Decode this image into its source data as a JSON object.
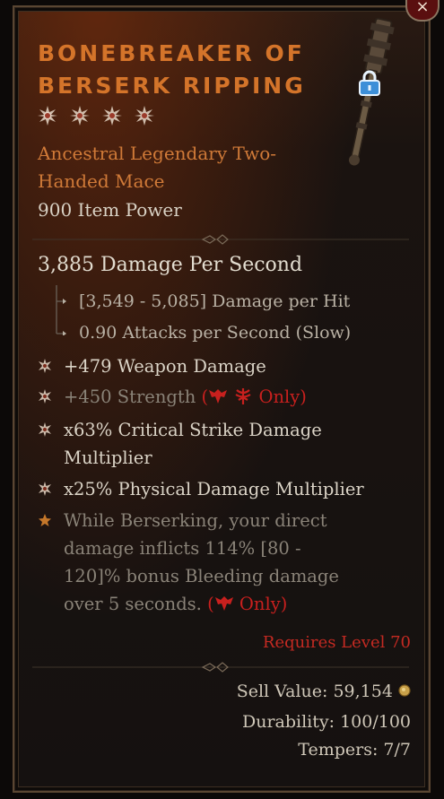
{
  "close_icon": "×",
  "item": {
    "title": "BONEBREAKER OF BERSERK RIPPING",
    "star_count": 4,
    "type": "Ancestral Legendary Two-Handed Mace",
    "power": "900 Item Power"
  },
  "stats": {
    "dps": "3,885 Damage Per Second",
    "damage_per_hit": "[3,549 - 5,085] Damage per Hit",
    "attack_speed": "0.90 Attacks per Second (Slow)"
  },
  "affixes": [
    {
      "text": "+479 Weapon Damage"
    },
    {
      "text": "+450 Strength",
      "restriction_open": "(",
      "restriction_close": "Only)"
    },
    {
      "text": "x63% Critical Strike Damage Multiplier"
    },
    {
      "text": "x25% Physical Damage Multiplier"
    }
  ],
  "aspect": {
    "text": "While Berserking, your direct damage inflicts 114% [80 - 120]% bonus Bleeding damage over 5 seconds.",
    "restriction_open": "(",
    "restriction_close": "Only)"
  },
  "requirement": "Requires Level 70",
  "footer": {
    "sell_value": "Sell Value: 59,154",
    "durability": "Durability: 100/100",
    "tempers": "Tempers: 7/7"
  },
  "colors": {
    "legendary_orange": "#d4742a",
    "restriction_red": "#c8201e",
    "text_light": "#dbd4c7"
  }
}
